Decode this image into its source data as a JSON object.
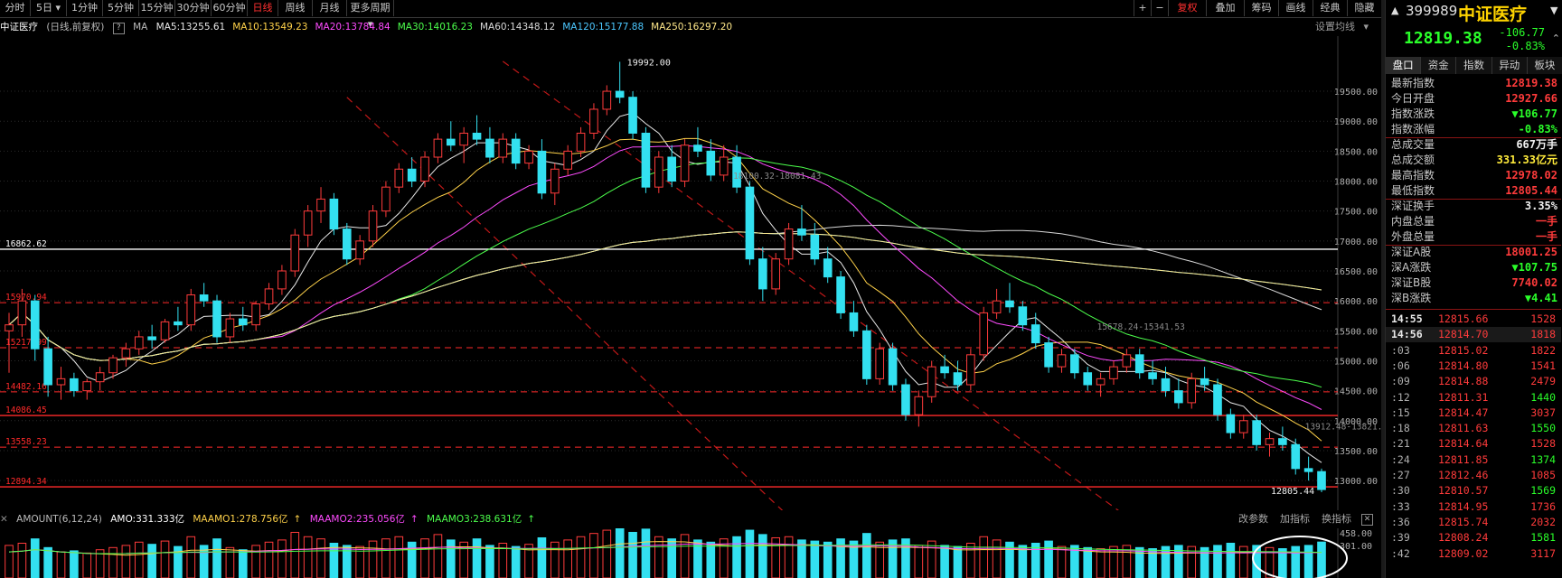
{
  "toolbar": {
    "periods": [
      "分时",
      "5日",
      "1分钟",
      "5分钟",
      "15分钟",
      "30分钟",
      "60分钟",
      "日线",
      "周线",
      "月线",
      "更多周期"
    ],
    "selected_period": "日线",
    "right_buttons": [
      "+",
      "−",
      "复权",
      "叠加",
      "筹码",
      "画线",
      "经典",
      "隐藏"
    ]
  },
  "info": {
    "name": "中证医疗",
    "mode": "(日线,前复权)",
    "help": "?",
    "ma_label": "MA",
    "ma": [
      {
        "text": "MA5:13255.61",
        "color": "#e8e8e8"
      },
      {
        "text": "MA10:13549.23",
        "color": "#ffd24a"
      },
      {
        "text": "MA20:13784.84",
        "color": "#ff4bff"
      },
      {
        "text": "MA30:14016.23",
        "color": "#4cff4c"
      },
      {
        "text": "MA60:14348.12",
        "color": "#d8d8d8"
      },
      {
        "text": "MA120:15177.88",
        "color": "#4cc8ff"
      },
      {
        "text": "MA250:16297.20",
        "color": "#ffe88a"
      }
    ],
    "ma_settings": "设置均线"
  },
  "chart_data": {
    "type": "candlestick",
    "y_ticks": [
      "19500.00",
      "19000.00",
      "18500.00",
      "18000.00",
      "17500.00",
      "17000.00",
      "16500.00",
      "16000.00",
      "15500.00",
      "15000.00",
      "14500.00",
      "14000.00",
      "13500.00",
      "13000.00"
    ],
    "ylim": [
      12700,
      20300
    ],
    "annotations": {
      "high": "19992.00",
      "low": "12805.44",
      "diag_label_1": "18100.32-18081.43",
      "diag_label_2": "15678.24-15341.53",
      "diag_label_3": "13912.48-13821.87"
    },
    "levels": [
      {
        "label": "16862.62",
        "value": 16862.62,
        "color": "#ffffff",
        "style": "solid"
      },
      {
        "label": "15970.94",
        "value": 15970.94,
        "color": "#ff2a2a",
        "style": "dashed"
      },
      {
        "label": "15217.99",
        "value": 15217.99,
        "color": "#ff2a2a",
        "style": "dashed"
      },
      {
        "label": "14482.16",
        "value": 14482.16,
        "color": "#ff2a2a",
        "style": "dashed"
      },
      {
        "label": "14086.45",
        "value": 14086.45,
        "color": "#ff2a2a",
        "style": "solid"
      },
      {
        "label": "13558.23",
        "value": 13558.23,
        "color": "#ff2a2a",
        "style": "dashed"
      },
      {
        "label": "12894.34",
        "value": 12894.34,
        "color": "#ff2a2a",
        "style": "solid"
      }
    ],
    "trend_channel": [
      [
        15350,
        20000
      ],
      [
        13200,
        12400
      ]
    ],
    "candles": [
      [
        15500,
        15800,
        14800,
        15600
      ],
      [
        15600,
        16200,
        15400,
        16000
      ],
      [
        16000,
        16100,
        15000,
        15200
      ],
      [
        15200,
        15400,
        14400,
        14600
      ],
      [
        14600,
        14900,
        14350,
        14700
      ],
      [
        14700,
        14800,
        14400,
        14500
      ],
      [
        14500,
        14700,
        14350,
        14650
      ],
      [
        14650,
        14900,
        14500,
        14800
      ],
      [
        14800,
        15100,
        14700,
        15050
      ],
      [
        15050,
        15300,
        14900,
        15200
      ],
      [
        15200,
        15500,
        15100,
        15400
      ],
      [
        15400,
        15600,
        15200,
        15350
      ],
      [
        15350,
        15700,
        15300,
        15650
      ],
      [
        15650,
        15900,
        15500,
        15600
      ],
      [
        15600,
        16200,
        15500,
        16100
      ],
      [
        16100,
        16300,
        15900,
        16000
      ],
      [
        16000,
        16100,
        15300,
        15400
      ],
      [
        15400,
        15800,
        15300,
        15700
      ],
      [
        15700,
        15900,
        15500,
        15600
      ],
      [
        15600,
        16000,
        15500,
        15950
      ],
      [
        15950,
        16300,
        15850,
        16200
      ],
      [
        16200,
        16600,
        16100,
        16500
      ],
      [
        16500,
        17200,
        16400,
        17100
      ],
      [
        17100,
        17600,
        16900,
        17500
      ],
      [
        17500,
        17900,
        17300,
        17700
      ],
      [
        17700,
        17800,
        17100,
        17200
      ],
      [
        17200,
        17300,
        16600,
        16700
      ],
      [
        16700,
        17100,
        16600,
        17000
      ],
      [
        17000,
        17600,
        16900,
        17500
      ],
      [
        17500,
        18000,
        17400,
        17900
      ],
      [
        17900,
        18300,
        17800,
        18200
      ],
      [
        18200,
        18400,
        17900,
        18000
      ],
      [
        18000,
        18500,
        17900,
        18400
      ],
      [
        18400,
        18800,
        18300,
        18700
      ],
      [
        18700,
        19000,
        18500,
        18600
      ],
      [
        18600,
        18900,
        18300,
        18800
      ],
      [
        18800,
        19100,
        18600,
        18700
      ],
      [
        18700,
        18900,
        18300,
        18400
      ],
      [
        18400,
        18800,
        18300,
        18700
      ],
      [
        18700,
        18800,
        18200,
        18300
      ],
      [
        18300,
        18600,
        18200,
        18500
      ],
      [
        18500,
        18700,
        17700,
        17800
      ],
      [
        17800,
        18300,
        17600,
        18200
      ],
      [
        18200,
        18600,
        18100,
        18500
      ],
      [
        18500,
        18900,
        18400,
        18800
      ],
      [
        18800,
        19300,
        18700,
        19200
      ],
      [
        19200,
        19600,
        19100,
        19500
      ],
      [
        19500,
        19992,
        19300,
        19400
      ],
      [
        19400,
        19500,
        18700,
        18800
      ],
      [
        18800,
        18900,
        17800,
        17900
      ],
      [
        17900,
        18500,
        17800,
        18400
      ],
      [
        18400,
        18600,
        17900,
        18000
      ],
      [
        18000,
        18700,
        17900,
        18600
      ],
      [
        18600,
        18900,
        18400,
        18500
      ],
      [
        18500,
        18700,
        18000,
        18100
      ],
      [
        18100,
        18600,
        18000,
        18400
      ],
      [
        18400,
        18600,
        17800,
        17900
      ],
      [
        17900,
        18000,
        16600,
        16700
      ],
      [
        16700,
        16900,
        16000,
        16200
      ],
      [
        16200,
        16800,
        16100,
        16700
      ],
      [
        16700,
        17300,
        16600,
        17200
      ],
      [
        17200,
        17600,
        17000,
        17100
      ],
      [
        17100,
        17300,
        16600,
        16700
      ],
      [
        16700,
        16900,
        16300,
        16400
      ],
      [
        16400,
        16500,
        15700,
        15800
      ],
      [
        15800,
        16000,
        15400,
        15500
      ],
      [
        15500,
        15600,
        14600,
        14700
      ],
      [
        14700,
        15300,
        14600,
        15200
      ],
      [
        15200,
        15300,
        14500,
        14600
      ],
      [
        14600,
        14700,
        14000,
        14100
      ],
      [
        14100,
        14500,
        13900,
        14400
      ],
      [
        14400,
        15000,
        14300,
        14900
      ],
      [
        14900,
        15100,
        14700,
        14800
      ],
      [
        14800,
        15000,
        14500,
        14600
      ],
      [
        14600,
        15200,
        14500,
        15100
      ],
      [
        15100,
        15900,
        15000,
        15800
      ],
      [
        15800,
        16200,
        15700,
        16000
      ],
      [
        16000,
        16300,
        15800,
        15900
      ],
      [
        15900,
        16000,
        15500,
        15600
      ],
      [
        15600,
        15800,
        15200,
        15300
      ],
      [
        15300,
        15400,
        14800,
        14900
      ],
      [
        14900,
        15200,
        14800,
        15100
      ],
      [
        15100,
        15200,
        14700,
        14800
      ],
      [
        14800,
        14900,
        14500,
        14600
      ],
      [
        14600,
        14800,
        14400,
        14700
      ],
      [
        14700,
        15000,
        14600,
        14900
      ],
      [
        14900,
        15200,
        14800,
        15100
      ],
      [
        15100,
        15200,
        14700,
        14800
      ],
      [
        14800,
        15000,
        14600,
        14700
      ],
      [
        14700,
        14900,
        14400,
        14500
      ],
      [
        14500,
        14700,
        14200,
        14300
      ],
      [
        14300,
        14800,
        14200,
        14700
      ],
      [
        14700,
        14900,
        14500,
        14600
      ],
      [
        14600,
        14700,
        14000,
        14100
      ],
      [
        14100,
        14200,
        13700,
        13800
      ],
      [
        13800,
        14100,
        13700,
        14000
      ],
      [
        14000,
        14100,
        13500,
        13600
      ],
      [
        13600,
        13800,
        13400,
        13700
      ],
      [
        13700,
        13900,
        13500,
        13600
      ],
      [
        13600,
        13700,
        13100,
        13200
      ],
      [
        13200,
        13400,
        13000,
        13150
      ],
      [
        13150,
        13200,
        12805,
        12850
      ]
    ],
    "volume": {
      "ylim": [
        0,
        480
      ],
      "y_ticks": [
        "458.00",
        "301.00"
      ],
      "values": [
        300,
        320,
        360,
        280,
        240,
        250,
        230,
        260,
        280,
        300,
        330,
        310,
        340,
        290,
        380,
        300,
        360,
        280,
        260,
        300,
        330,
        350,
        420,
        380,
        360,
        320,
        300,
        290,
        340,
        360,
        380,
        330,
        360,
        400,
        350,
        330,
        360,
        300,
        320,
        290,
        310,
        370,
        330,
        350,
        380,
        410,
        440,
        460,
        420,
        450,
        380,
        360,
        400,
        350,
        330,
        360,
        380,
        440,
        400,
        370,
        380,
        350,
        340,
        330,
        360,
        340,
        410,
        330,
        350,
        360,
        300,
        340,
        300,
        290,
        320,
        380,
        350,
        330,
        300,
        320,
        340,
        290,
        300,
        280,
        270,
        290,
        300,
        280,
        270,
        290,
        300,
        290,
        280,
        300,
        320,
        290,
        300,
        280,
        270,
        290,
        300,
        331
      ],
      "ma1": 278.756,
      "ma2": 235.056,
      "ma3": 238.631
    }
  },
  "volume_bar": {
    "title": "AMOUNT(6,12,24)",
    "amo": "AMO:331.333亿",
    "maamo1": "MAAMO1:278.756亿",
    "maamo2": "MAAMO2:235.056亿",
    "maamo3": "MAAMO3:238.631亿",
    "buttons": [
      "改参数",
      "加指标",
      "换指标"
    ]
  },
  "quote": {
    "code": "399989",
    "name": "中证医疗",
    "price": "12819.38",
    "change": "-106.77",
    "change_pct": "-0.83%",
    "tabs": [
      "盘口",
      "资金",
      "指数",
      "异动",
      "板块"
    ],
    "rows": [
      {
        "label": "最新指数",
        "value": "12819.38",
        "color": "#ff3b3b"
      },
      {
        "label": "今日开盘",
        "value": "12927.66",
        "color": "#ff3b3b"
      },
      {
        "label": "指数涨跌",
        "value": "▼106.77",
        "color": "#2aff2a"
      },
      {
        "label": "指数涨幅",
        "value": "-0.83%",
        "color": "#2aff2a"
      },
      {
        "label": "总成交量",
        "value": "667万手",
        "color": "#f0f0f0"
      },
      {
        "label": "总成交额",
        "value": "331.33亿元",
        "color": "#ffeb3b"
      },
      {
        "label": "最高指数",
        "value": "12978.02",
        "color": "#ff3b3b"
      },
      {
        "label": "最低指数",
        "value": "12805.44",
        "color": "#ff3b3b"
      },
      {
        "label": "深证换手",
        "value": "3.35%",
        "color": "#f0f0f0"
      },
      {
        "label": "内盘总量",
        "value": "一手",
        "color": "#ff3b3b"
      },
      {
        "label": "外盘总量",
        "value": "一手",
        "color": "#ff3b3b"
      },
      {
        "label": "深证A股",
        "value": "18001.25",
        "color": "#ff3b3b"
      },
      {
        "label": "深A涨跌",
        "value": "▼107.75",
        "color": "#2aff2a"
      },
      {
        "label": "深证B股",
        "value": "7740.02",
        "color": "#ff3b3b"
      },
      {
        "label": "深B涨跌",
        "value": "▼4.41",
        "color": "#2aff2a"
      }
    ],
    "ticks": [
      {
        "t": "14:55",
        "p": "12815.66",
        "v": "1528",
        "vc": "#ff3b3b"
      },
      {
        "t": "14:56",
        "p": "12814.70",
        "v": "1818",
        "vc": "#ff3b3b"
      },
      {
        "t": ":03",
        "p": "12815.02",
        "v": "1822",
        "vc": "#ff3b3b"
      },
      {
        "t": ":06",
        "p": "12814.80",
        "v": "1541",
        "vc": "#ff3b3b"
      },
      {
        "t": ":09",
        "p": "12814.88",
        "v": "2479",
        "vc": "#ff3b3b"
      },
      {
        "t": ":12",
        "p": "12811.31",
        "v": "1440",
        "vc": "#2aff2a"
      },
      {
        "t": ":15",
        "p": "12814.47",
        "v": "3037",
        "vc": "#ff3b3b"
      },
      {
        "t": ":18",
        "p": "12811.63",
        "v": "1550",
        "vc": "#2aff2a"
      },
      {
        "t": ":21",
        "p": "12814.64",
        "v": "1528",
        "vc": "#ff3b3b"
      },
      {
        "t": ":24",
        "p": "12811.85",
        "v": "1374",
        "vc": "#2aff2a"
      },
      {
        "t": ":27",
        "p": "12812.46",
        "v": "1085",
        "vc": "#ff3b3b"
      },
      {
        "t": ":30",
        "p": "12810.57",
        "v": "1569",
        "vc": "#2aff2a"
      },
      {
        "t": ":33",
        "p": "12814.95",
        "v": "1736",
        "vc": "#ff3b3b"
      },
      {
        "t": ":36",
        "p": "12815.74",
        "v": "2032",
        "vc": "#ff3b3b"
      },
      {
        "t": ":39",
        "p": "12808.24",
        "v": "1581",
        "vc": "#2aff2a"
      },
      {
        "t": ":42",
        "p": "12809.02",
        "v": "3117",
        "vc": "#ff3b3b"
      }
    ]
  }
}
